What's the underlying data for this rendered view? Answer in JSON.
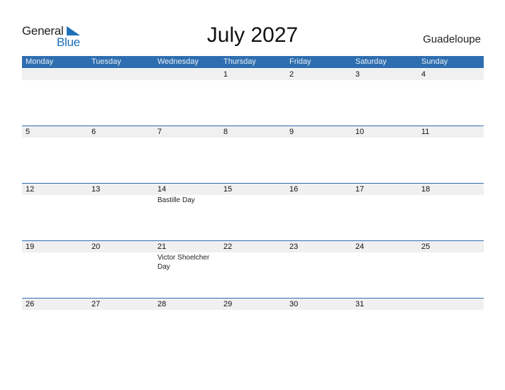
{
  "logo": {
    "word1": "General",
    "word2": "Blue",
    "icon": "triangle-flag-icon"
  },
  "title": "July 2027",
  "country": "Guadeloupe",
  "colors": {
    "accent": "#2e6eb0",
    "logo_blue": "#1e6fba",
    "row_bg": "#f0f0f0"
  },
  "weekdays": [
    "Monday",
    "Tuesday",
    "Wednesday",
    "Thursday",
    "Friday",
    "Saturday",
    "Sunday"
  ],
  "weeks": [
    {
      "days": [
        "",
        "",
        "",
        "1",
        "2",
        "3",
        "4"
      ],
      "events": [
        "",
        "",
        "",
        "",
        "",
        "",
        ""
      ]
    },
    {
      "days": [
        "5",
        "6",
        "7",
        "8",
        "9",
        "10",
        "11"
      ],
      "events": [
        "",
        "",
        "",
        "",
        "",
        "",
        ""
      ]
    },
    {
      "days": [
        "12",
        "13",
        "14",
        "15",
        "16",
        "17",
        "18"
      ],
      "events": [
        "",
        "",
        "Bastille Day",
        "",
        "",
        "",
        ""
      ]
    },
    {
      "days": [
        "19",
        "20",
        "21",
        "22",
        "23",
        "24",
        "25"
      ],
      "events": [
        "",
        "",
        "Victor Shoelcher Day",
        "",
        "",
        "",
        ""
      ]
    },
    {
      "days": [
        "26",
        "27",
        "28",
        "29",
        "30",
        "31",
        ""
      ],
      "events": [
        "",
        "",
        "",
        "",
        "",
        "",
        ""
      ]
    }
  ]
}
